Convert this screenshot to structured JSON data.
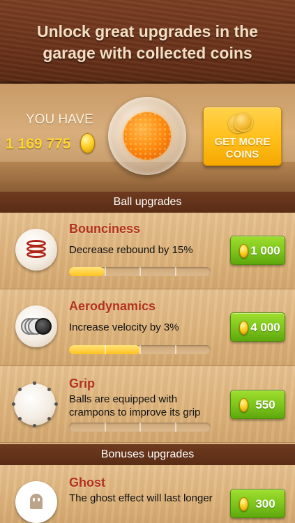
{
  "header": {
    "title": "Unlock great upgrades in the garage with collected coins"
  },
  "wallet": {
    "you_have_label": "YOU HAVE",
    "coins": "1 169 775",
    "get_more_label": "GET MORE COINS"
  },
  "sections": {
    "ball_upgrades": "Ball upgrades",
    "bonuses_upgrades": "Bonuses upgrades"
  },
  "upgrades": [
    {
      "title": "Bounciness",
      "description": "Decrease rebound by 15%",
      "price": "1 000",
      "progress_levels": 4,
      "progress_filled": 1,
      "icon": "spring-icon"
    },
    {
      "title": "Aerodynamics",
      "description": "Increase velocity by 3%",
      "price": "4 000",
      "progress_levels": 4,
      "progress_filled": 2,
      "icon": "aerodynamics-icon"
    },
    {
      "title": "Grip",
      "description": "Balls are equipped with crampons to improve its grip",
      "price": "550",
      "progress_levels": 4,
      "progress_filled": 0,
      "icon": "grip-ball-icon"
    }
  ],
  "bonuses": [
    {
      "title": "Ghost",
      "description": "The ghost effect will last longer",
      "price": "300",
      "icon": "ghost-icon"
    }
  ],
  "colors": {
    "title_red": "#b1321a",
    "buy_green": "#7cc41c",
    "coin_gold": "#ffd531",
    "wood_dark": "#6e3a1f"
  }
}
